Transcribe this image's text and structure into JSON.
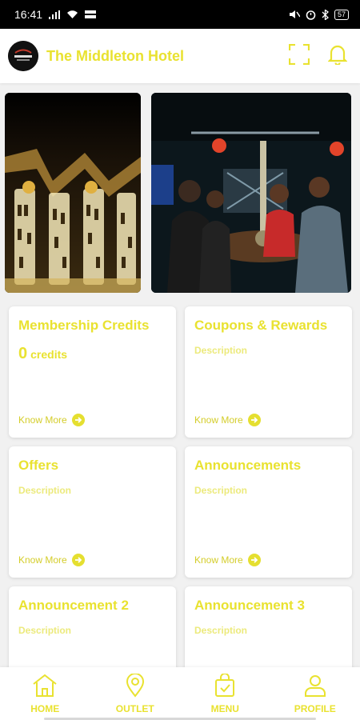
{
  "status_bar": {
    "time": "16:41",
    "battery": "57"
  },
  "header": {
    "title": "The Middleton Hotel"
  },
  "cards": [
    {
      "title": "Membership Credits",
      "credits_value": "0",
      "credits_unit": "credits",
      "link": "Know More"
    },
    {
      "title": "Coupons & Rewards",
      "description": "Description",
      "link": "Know More"
    },
    {
      "title": "Offers",
      "description": "Description",
      "link": "Know More"
    },
    {
      "title": "Announcements",
      "description": "Description",
      "link": "Know More"
    },
    {
      "title": "Announcement 2",
      "description": "Description"
    },
    {
      "title": "Announcement 3",
      "description": "Description"
    }
  ],
  "nav": [
    {
      "label": "HOME",
      "icon": "home-icon"
    },
    {
      "label": "OUTLET",
      "icon": "location-pin-icon"
    },
    {
      "label": "MENU",
      "icon": "shopping-bag-icon"
    },
    {
      "label": "PROFILE",
      "icon": "user-icon"
    }
  ],
  "colors": {
    "accent": "#e9e230",
    "description": "#ecea7c",
    "status_bar": "#000000"
  }
}
